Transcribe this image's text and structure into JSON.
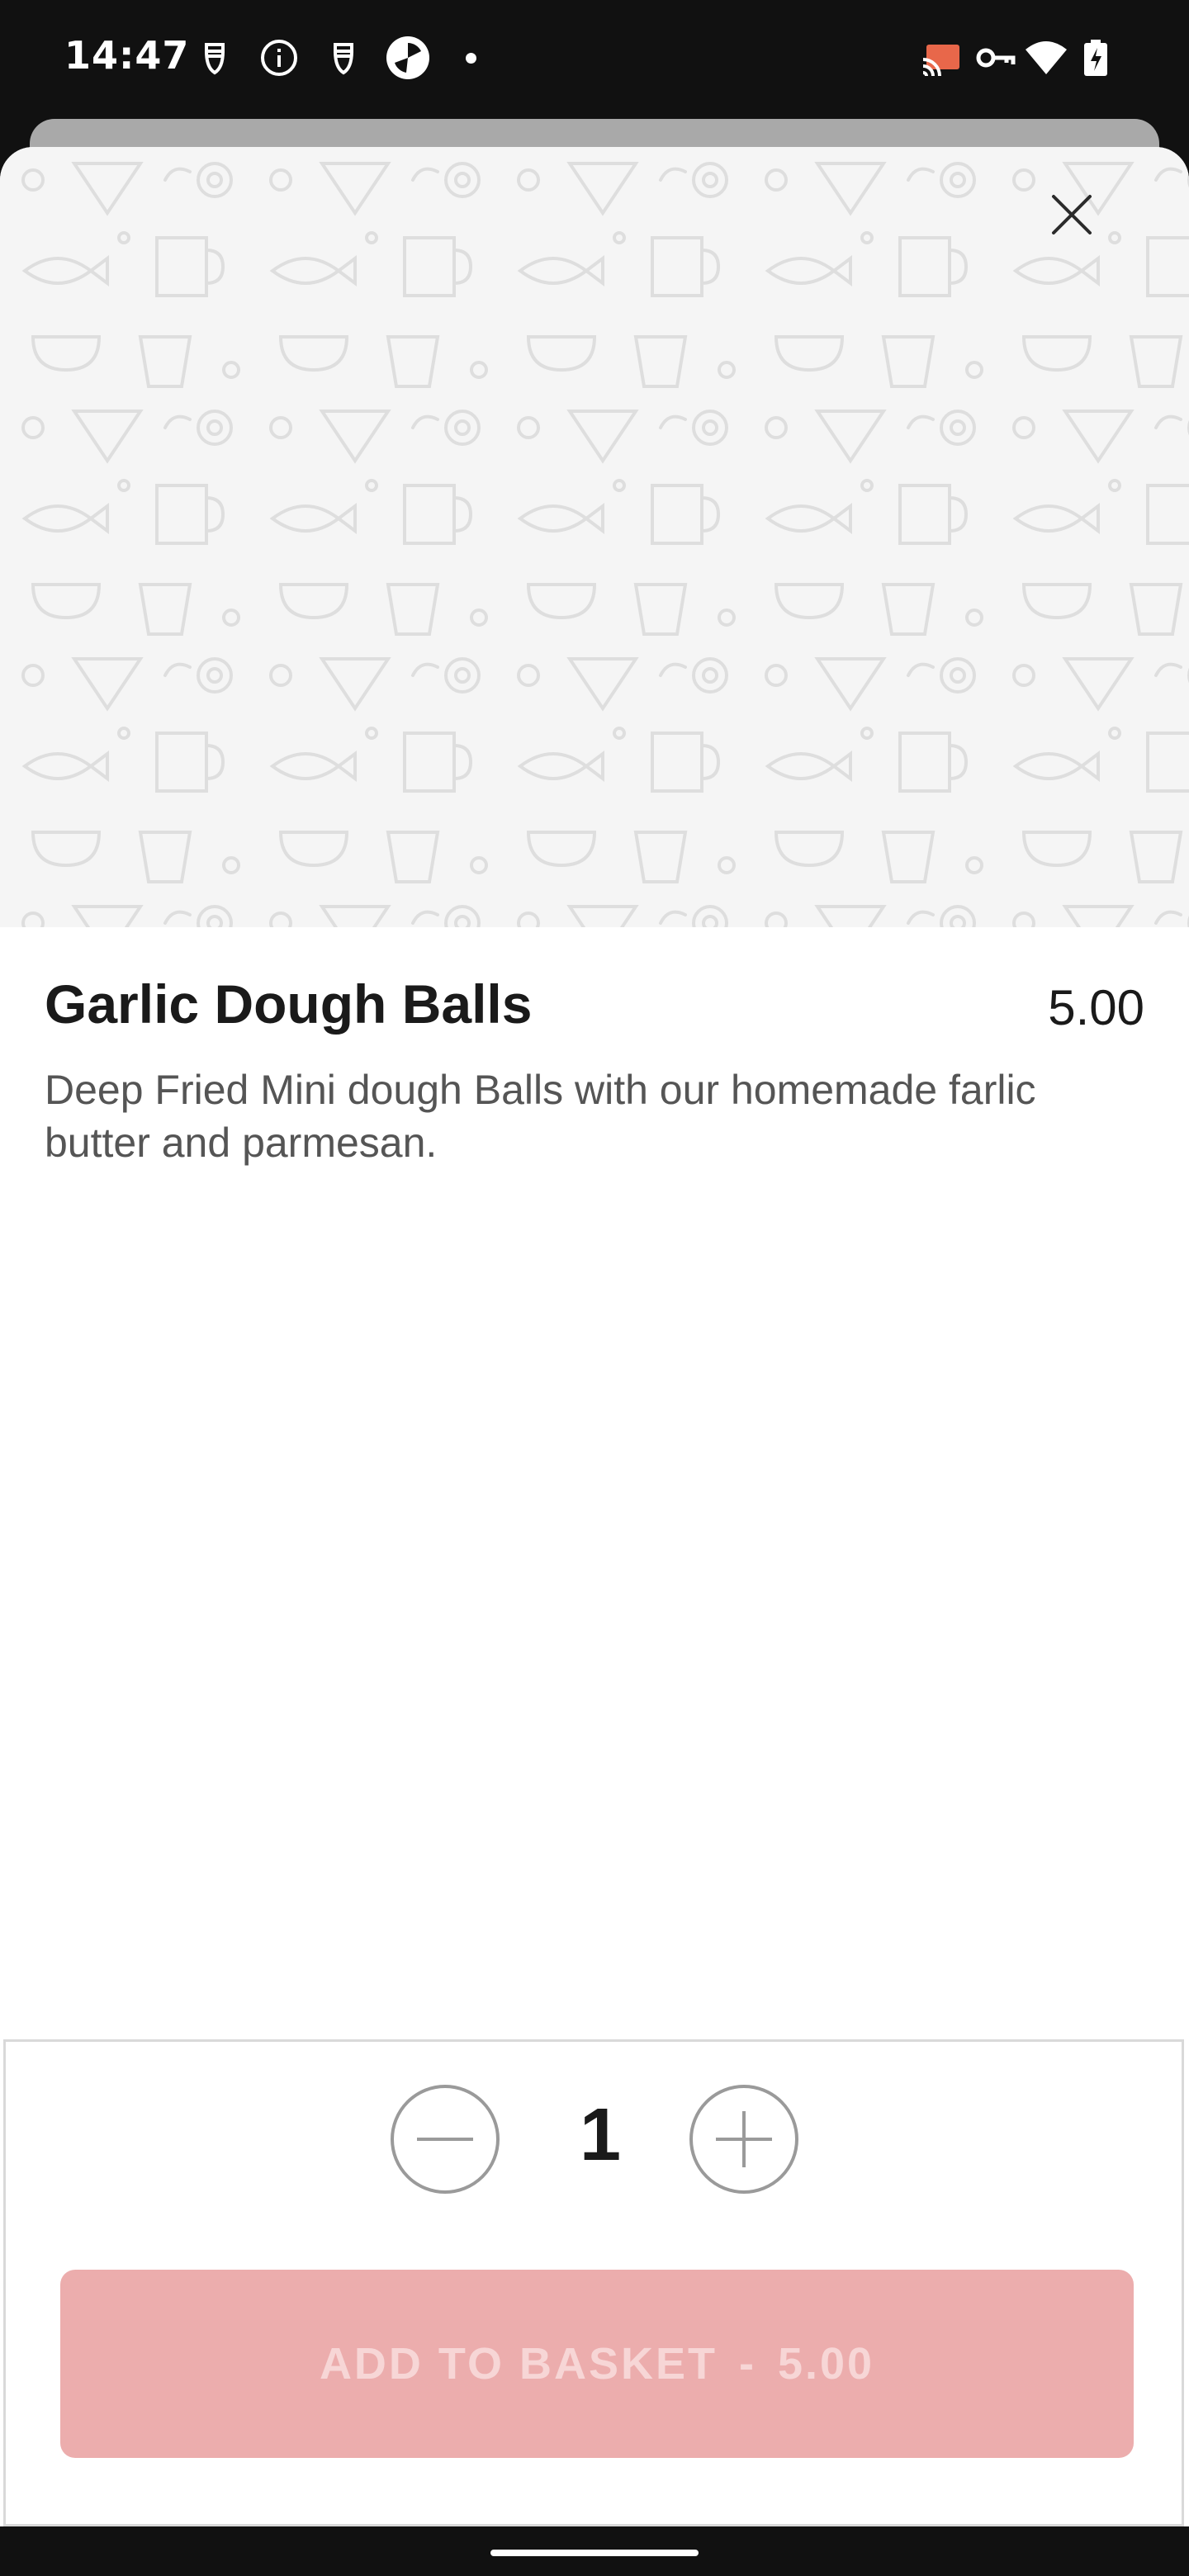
{
  "status_bar": {
    "time": "14:47",
    "left_icons": [
      "sim-shield-icon",
      "info-icon",
      "sim-shield-icon",
      "camera-app-icon",
      "notification-dot-icon"
    ],
    "right_icons": [
      "cast-icon",
      "vpn-key-icon",
      "wifi-icon",
      "battery-charging-icon"
    ]
  },
  "item": {
    "name": "Garlic Dough Balls",
    "price": "5.00",
    "description": "Deep Fried Mini dough Balls with our homemade farlic butter and parmesan."
  },
  "quantity": {
    "value": "1"
  },
  "add_button": {
    "label": "ADD TO BASKET",
    "separator": "-",
    "price": "5.00"
  },
  "colors": {
    "accent_disabled": "#ecadad",
    "hero_background": "#f5f5f5",
    "status_bar": "#111111"
  }
}
